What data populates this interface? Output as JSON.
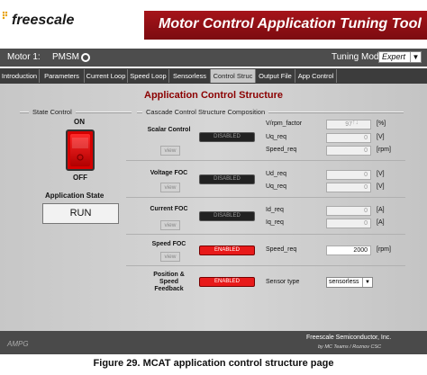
{
  "header": {
    "logo_text": "freescale",
    "app_title": "Motor Control Application Tuning Tool"
  },
  "motorbar": {
    "motor_label": "Motor 1:",
    "motor_type": "PMSM",
    "tuning_label": "Tuning Mode:",
    "tuning_value": "Expert"
  },
  "tabs": [
    "Introduction",
    "Parameters",
    "Current Loop",
    "Speed Loop",
    "Sensorless",
    "Control Struc",
    "Output File",
    "App Control"
  ],
  "active_tab": "Control Struc",
  "panel": {
    "title": "Application Control Structure",
    "state_control_header": "State Control",
    "cascade_header": "Cascade Control Structure Composition",
    "switch_on": "ON",
    "switch_off": "OFF",
    "app_state_label": "Application State",
    "app_state_value": "RUN"
  },
  "rows": {
    "scalar": {
      "label": "Scalar Control",
      "status": "DISABLED",
      "view": "view",
      "params": [
        {
          "name": "V/rpm_factor",
          "value": "97",
          "unit": "[%]"
        },
        {
          "name": "Uq_req",
          "value": "0",
          "unit": "[V]"
        },
        {
          "name": "Speed_req",
          "value": "0",
          "unit": "[rpm]"
        }
      ]
    },
    "voltage": {
      "label": "Voltage FOC",
      "status": "DISABLED",
      "view": "view",
      "params": [
        {
          "name": "Ud_req",
          "value": "0",
          "unit": "[V]"
        },
        {
          "name": "Uq_req",
          "value": "0",
          "unit": "[V]"
        }
      ]
    },
    "current": {
      "label": "Current FOC",
      "status": "DISABLED",
      "view": "view",
      "params": [
        {
          "name": "Id_req",
          "value": "0",
          "unit": "[A]"
        },
        {
          "name": "Iq_req",
          "value": "0",
          "unit": "[A]"
        }
      ]
    },
    "speed": {
      "label": "Speed FOC",
      "status": "ENABLED",
      "view": "view",
      "params": [
        {
          "name": "Speed_req",
          "value": "2000",
          "unit": "[rpm]"
        }
      ]
    },
    "position": {
      "label_l1": "Position &",
      "label_l2": "Speed",
      "label_l3": "Feedback",
      "status": "ENABLED",
      "sensor_label": "Sensor type",
      "sensor_value": "sensorless"
    }
  },
  "footer": {
    "left": "AMPG",
    "right_line1": "Freescale Semiconductor, Inc.",
    "right_line2": "by MC Teams / Roznov CSC"
  },
  "caption": "Figure 29.   MCAT application control structure page",
  "colors": {
    "accent_red": "#a6141a",
    "led_on": "#e81a1a",
    "panel_title": "#8b0000"
  }
}
